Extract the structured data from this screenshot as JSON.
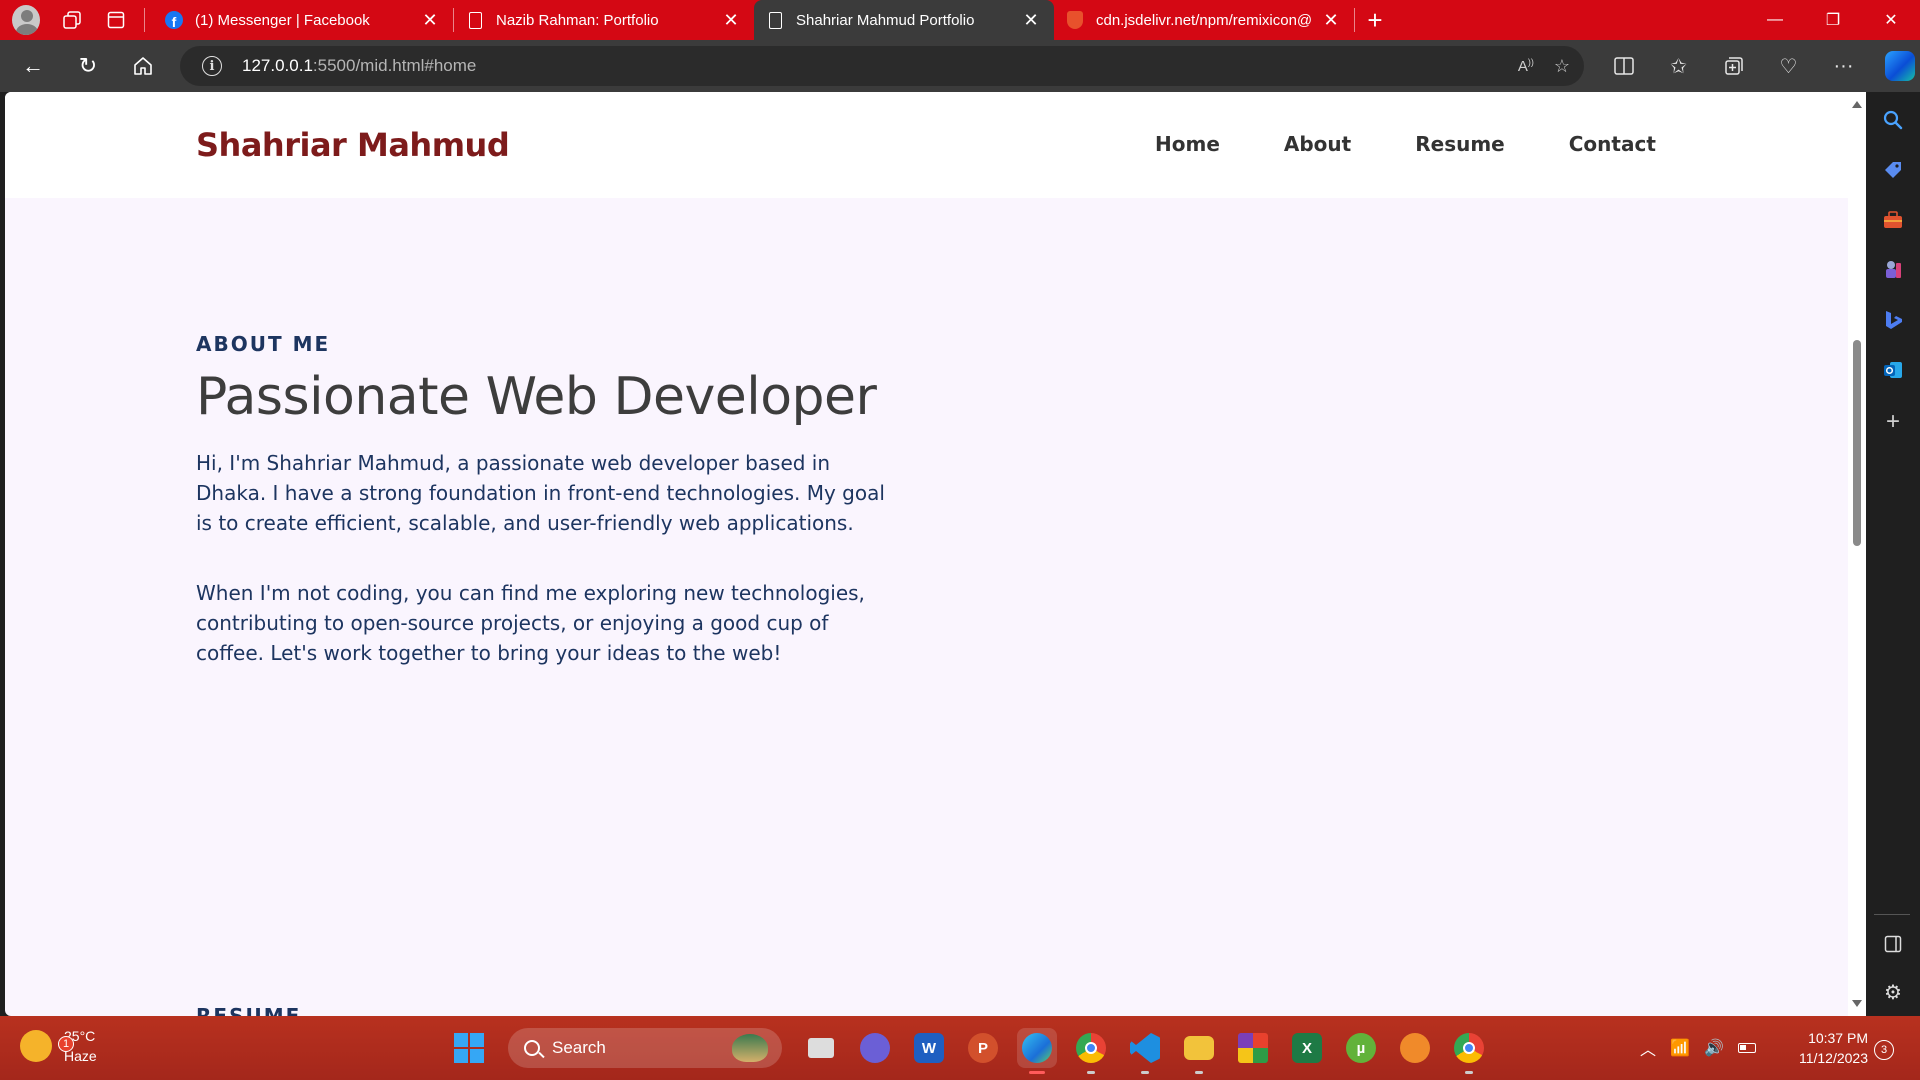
{
  "browser": {
    "tabs": [
      {
        "title": "(1) Messenger | Facebook",
        "favicon": "facebook-icon",
        "active": false
      },
      {
        "title": "Nazib Rahman: Portfolio",
        "favicon": "document-icon",
        "active": false
      },
      {
        "title": "Shahriar Mahmud Portfolio",
        "favicon": "document-icon",
        "active": true
      },
      {
        "title": "cdn.jsdelivr.net/npm/remixicon@",
        "favicon": "shield-icon",
        "active": false
      }
    ],
    "url_host": "127.0.0.1",
    "url_path": ":5500/mid.html#home"
  },
  "site": {
    "brand": "Shahriar Mahmud",
    "nav": [
      "Home",
      "About",
      "Resume",
      "Contact"
    ],
    "about": {
      "eyebrow": "ABOUT ME",
      "headline": "Passionate Web Developer",
      "paragraph1": "Hi, I'm Shahriar Mahmud, a passionate web developer based in Dhaka. I have a strong foundation in front-end technologies. My goal is to create efficient, scalable, and user-friendly web applications.",
      "paragraph2": "When I'm not coding, you can find me exploring new technologies, contributing to open-source projects, or enjoying a good cup of coffee. Let's work together to bring your ideas to the web!"
    },
    "next_section_eyebrow": "RESUME"
  },
  "taskbar": {
    "weather_temp": "25°C",
    "weather_desc": "Haze",
    "weather_badge": "1",
    "search_placeholder": "Search",
    "time": "10:37 PM",
    "date": "11/12/2023",
    "notification_count": "3"
  },
  "colors": {
    "tabstrip": "#d40814",
    "brand": "#7d1b1b",
    "accent_text": "#1d3560",
    "page_bg": "#faf5fe"
  }
}
